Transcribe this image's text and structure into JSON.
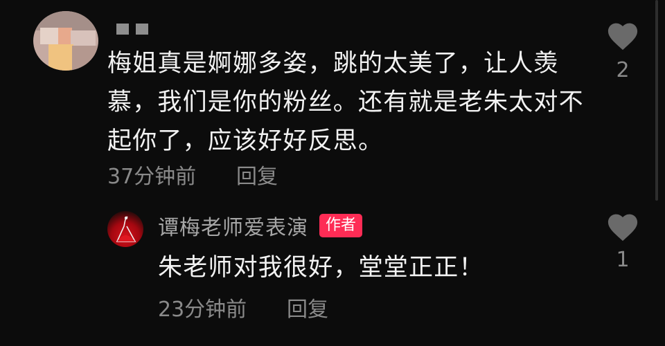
{
  "comment": {
    "avatar_icon": "pixelated-avatar-icon",
    "username_icon": "censored-username",
    "text": "梅姐真是婀娜多姿，跳的太美了，让人羡慕，我们是你的粉丝。还有就是老朱太对不起你了，应该好好反思。",
    "time": "37分钟前",
    "reply_label": "回复",
    "likes": "2"
  },
  "reply": {
    "avatar_icon": "dancer-avatar-icon",
    "author": "谭梅老师爱表演",
    "badge": "作者",
    "text": "朱老师对我很好，堂堂正正！",
    "time": "23分钟前",
    "reply_label": "回复",
    "likes": "1"
  },
  "colors": {
    "background": "#0c0c0c",
    "text": "#f2f2f2",
    "muted": "#8a8a8a",
    "badge": "#fe2c55",
    "heart": "#6a6a6a"
  }
}
